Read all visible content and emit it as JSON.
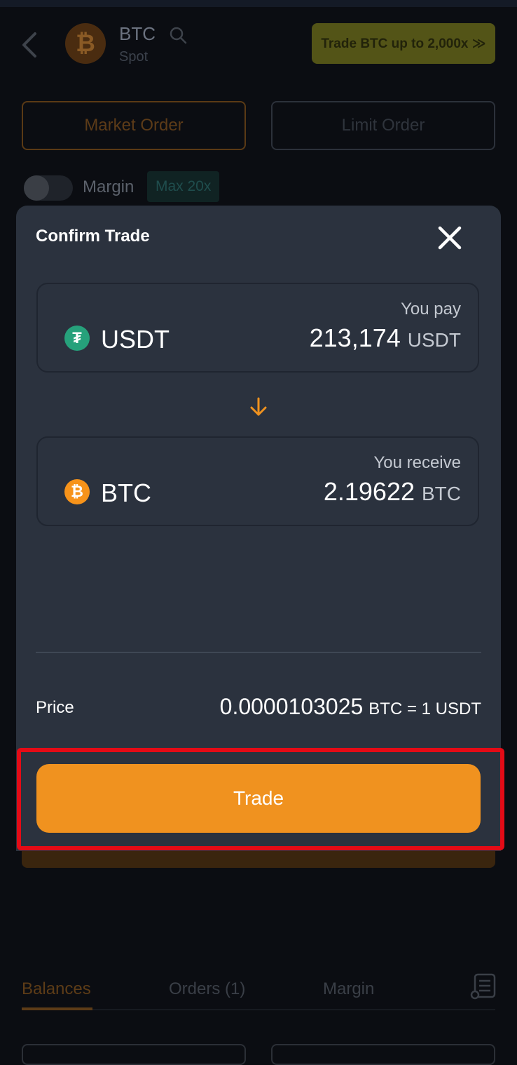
{
  "header": {
    "pair": "BTC",
    "pair_sub": "Spot",
    "coin_glyph": "₿",
    "promo": "Trade BTC up to 2,000x ≫"
  },
  "order_tabs": {
    "market": "Market Order",
    "limit": "Limit Order"
  },
  "margin": {
    "label": "Margin",
    "max_badge": "Max 20x",
    "enabled": false
  },
  "modal": {
    "title": "Confirm Trade",
    "pay": {
      "coin": "USDT",
      "glyph": "₮",
      "label": "You pay",
      "amount": "213,174",
      "unit": "USDT"
    },
    "receive": {
      "coin": "BTC",
      "glyph": "₿",
      "label": "You receive",
      "amount": "2.19622",
      "unit": "BTC"
    },
    "price": {
      "label": "Price",
      "value": "0.0000103025",
      "unit": "BTC = 1 USDT"
    },
    "trade_button": "Trade"
  },
  "bottom_tabs": {
    "balances": "Balances",
    "orders": "Orders (1)",
    "margin": "Margin"
  },
  "colors": {
    "accent": "#f0921f",
    "highlight": "#e40b16",
    "usdt": "#26a17b",
    "btc": "#f7931a"
  }
}
